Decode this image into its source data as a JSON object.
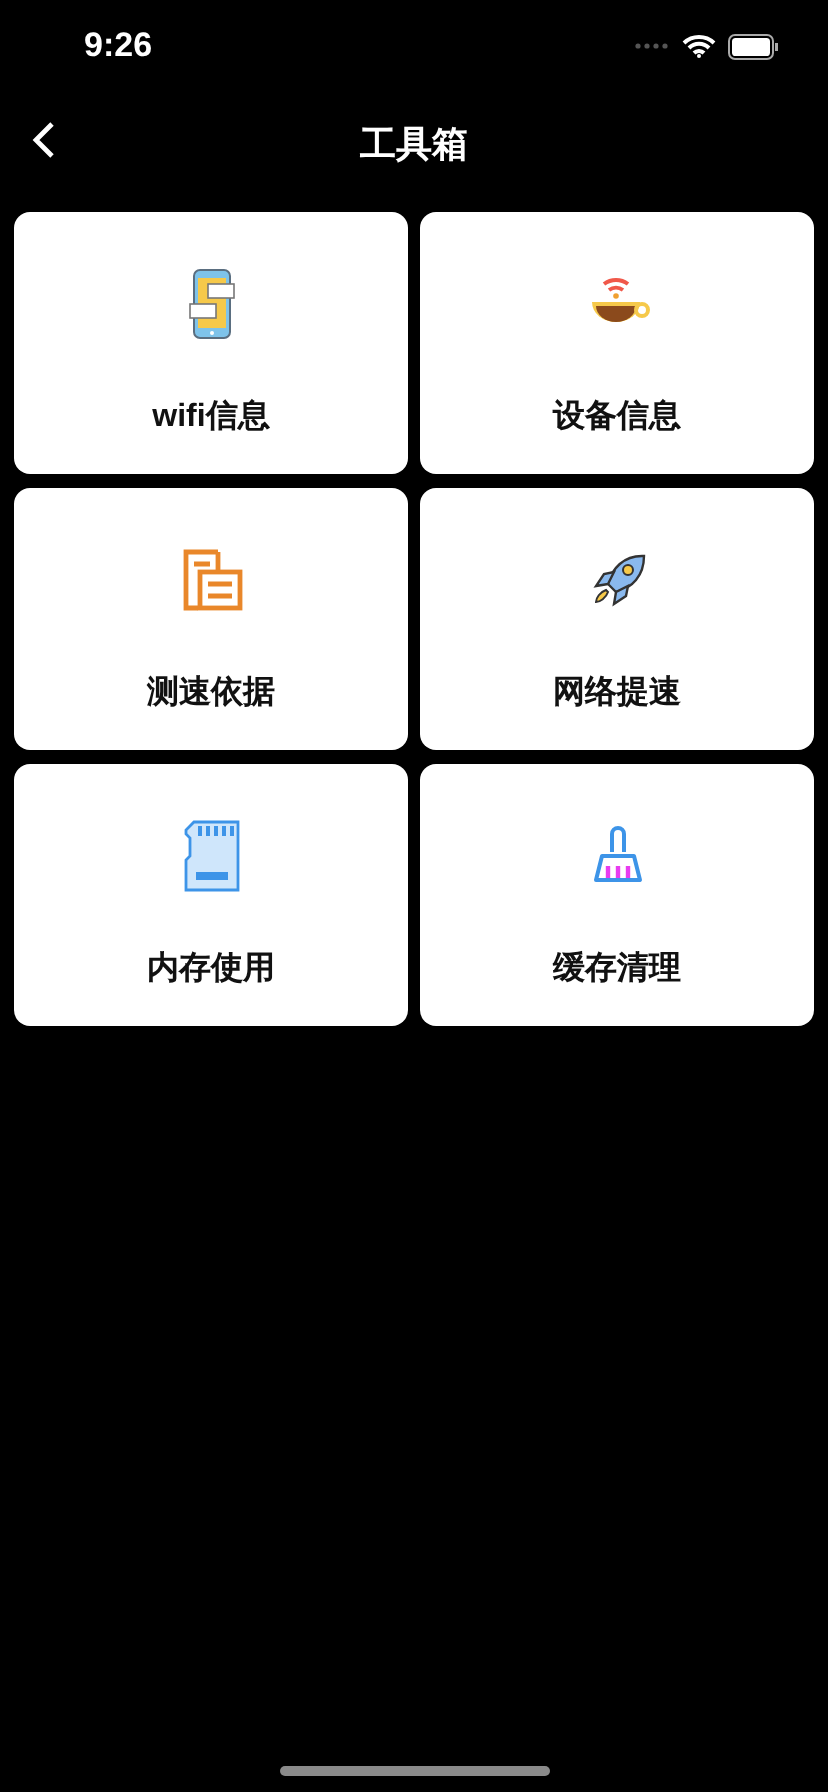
{
  "status_bar": {
    "time": "9:26"
  },
  "nav": {
    "title": "工具箱"
  },
  "tools": [
    {
      "kind": "phone",
      "label": "wifi信息"
    },
    {
      "kind": "cup",
      "label": "设备信息"
    },
    {
      "kind": "document",
      "label": "测速依据"
    },
    {
      "kind": "rocket",
      "label": "网络提速"
    },
    {
      "kind": "sdcard",
      "label": "内存使用"
    },
    {
      "kind": "broom",
      "label": "缓存清理"
    }
  ]
}
